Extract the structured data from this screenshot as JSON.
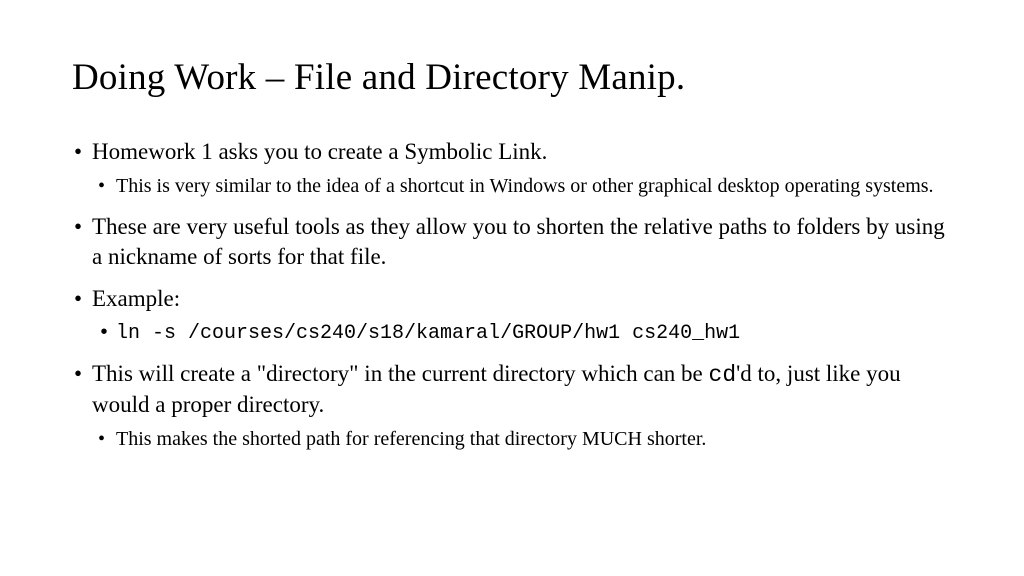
{
  "title": "Doing Work – File and Directory Manip.",
  "bullets": {
    "b1": "Homework 1 asks you to create a Symbolic Link.",
    "b1_sub1": "This is very similar to the idea of a shortcut in Windows or other graphical desktop operating systems.",
    "b2": "These are very useful tools as they allow you to shorten the relative paths to folders by using a nickname of sorts for that file.",
    "b3": "Example:",
    "b3_code": "ln -s /courses/cs240/s18/kamaral/GROUP/hw1 cs240_hw1",
    "b4_pre": "This will create a \"directory\" in the current directory which can be ",
    "b4_cd": "cd",
    "b4_post": "'d to, just like you would a proper directory.",
    "b4_sub1": "This makes the shorted path for referencing that directory MUCH shorter."
  }
}
